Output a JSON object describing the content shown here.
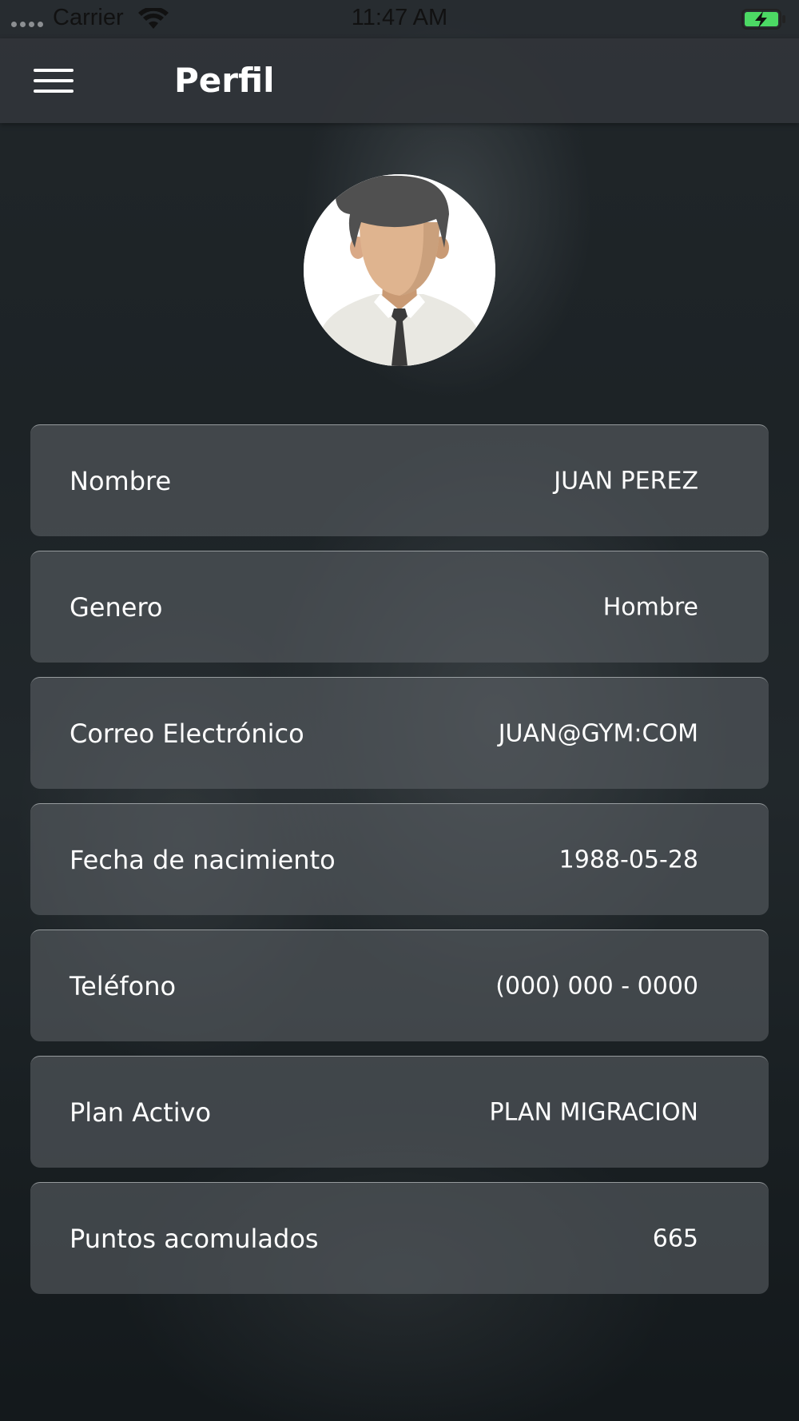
{
  "status_bar": {
    "carrier": "Carrier",
    "time": "11:47 AM",
    "icons": [
      "signal-dots-icon",
      "wifi-icon",
      "battery-charging-icon"
    ]
  },
  "nav": {
    "title": "Perfil",
    "menu_icon": "hamburger-menu-icon"
  },
  "avatar": {
    "icon": "user-avatar-icon"
  },
  "profile_fields": [
    {
      "label": "Nombre",
      "value": "JUAN PEREZ"
    },
    {
      "label": "Genero",
      "value": "Hombre"
    },
    {
      "label": "Correo Electrónico",
      "value": "JUAN@GYM:COM"
    },
    {
      "label": "Fecha de nacimiento",
      "value": "1988-05-28"
    },
    {
      "label": "Teléfono",
      "value": "(000) 000 - 0000"
    },
    {
      "label": "Plan Activo",
      "value": "PLAN MIGRACION"
    },
    {
      "label": "Puntos acomulados",
      "value": "665"
    }
  ],
  "colors": {
    "battery_fill": "#4cd964",
    "row_background": "#585e62",
    "nav_background": "#32363a"
  }
}
